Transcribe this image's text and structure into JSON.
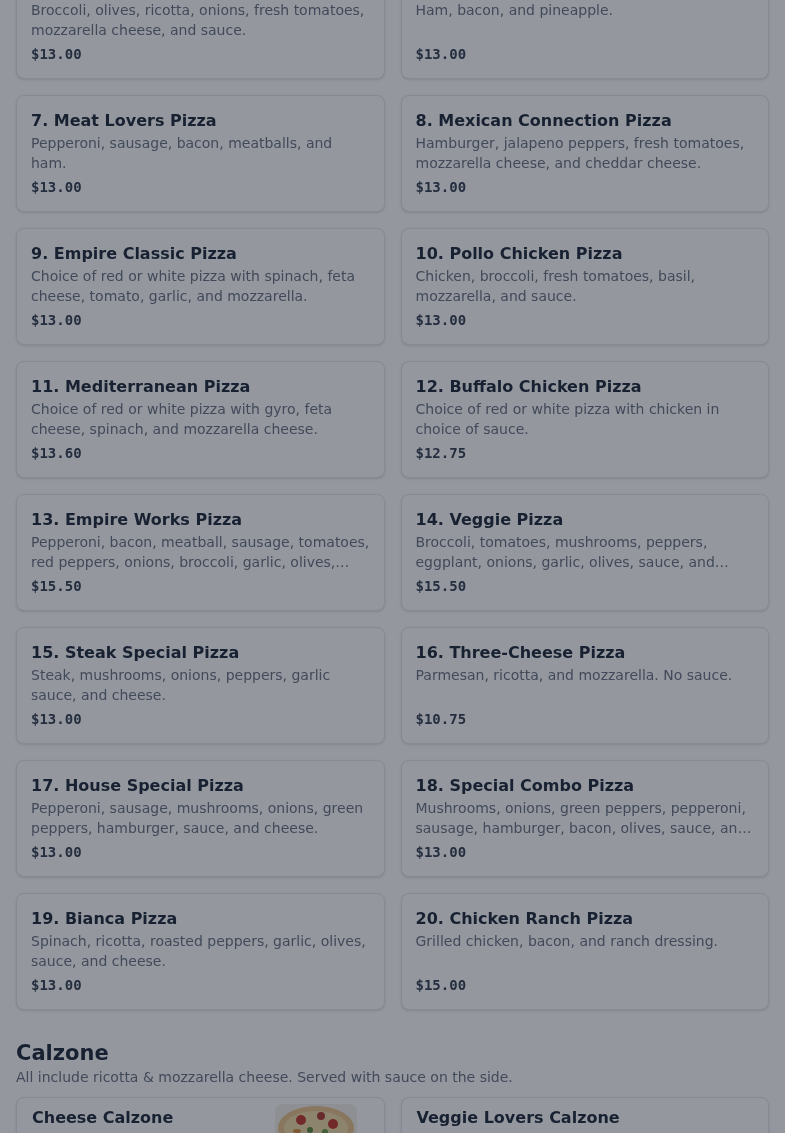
{
  "backdrop_dimmed": true,
  "pizza_items": [
    {
      "description": "Broccoli, olives, ricotta, onions, fresh tomatoes, mozzarella cheese, and sauce.",
      "price": "$13.00"
    },
    {
      "description": "Ham, bacon, and pineapple.",
      "price": "$13.00"
    },
    {
      "name": "7. Meat Lovers Pizza",
      "description": "Pepperoni, sausage, bacon, meatballs, and ham.",
      "price": "$13.00"
    },
    {
      "name": "8. Mexican Connection Pizza",
      "description": "Hamburger, jalapeno peppers, fresh tomatoes, mozzarella cheese, and cheddar cheese.",
      "price": "$13.00"
    },
    {
      "name": "9. Empire Classic Pizza",
      "description": "Choice of red or white pizza with spinach, feta cheese, tomato, garlic, and mozzarella.",
      "price": "$13.00"
    },
    {
      "name": "10. Pollo Chicken Pizza",
      "description": "Chicken, broccoli, fresh tomatoes, basil, mozzarella, and sauce.",
      "price": "$13.00"
    },
    {
      "name": "11. Mediterranean Pizza",
      "description": "Choice of red or white pizza with gyro, feta cheese, spinach, and mozzarella cheese.",
      "price": "$13.60"
    },
    {
      "name": "12. Buffalo Chicken Pizza",
      "description": "Choice of red or white pizza with chicken in choice of sauce.",
      "price": "$12.75"
    },
    {
      "name": "13. Empire Works Pizza",
      "description": "Pepperoni, bacon, meatball, sausage, tomatoes, red peppers, onions, broccoli, garlic, olives,…",
      "price": "$15.50"
    },
    {
      "name": "14. Veggie Pizza",
      "description": "Broccoli, tomatoes, mushrooms, peppers, eggplant, onions, garlic, olives, sauce, and…",
      "price": "$15.50"
    },
    {
      "name": "15. Steak Special Pizza",
      "description": "Steak, mushrooms, onions, peppers, garlic sauce, and cheese.",
      "price": "$13.00"
    },
    {
      "name": "16. Three-Cheese Pizza",
      "description": "Parmesan, ricotta, and mozzarella. No sauce.",
      "price": "$10.75"
    },
    {
      "name": "17. House Special Pizza",
      "description": "Pepperoni, sausage, mushrooms, onions, green peppers, hamburger, sauce, and cheese.",
      "price": "$13.00"
    },
    {
      "name": "18. Special Combo Pizza",
      "description": "Mushrooms, onions, green peppers, pepperoni, sausage, hamburger, bacon, olives, sauce, an…",
      "price": "$13.00"
    },
    {
      "name": "19. Bianca Pizza",
      "description": "Spinach, ricotta, roasted peppers, garlic, olives, sauce, and cheese.",
      "price": "$13.00"
    },
    {
      "name": "20. Chicken Ranch Pizza",
      "description": "Grilled chicken, bacon, and ranch dressing.",
      "price": "$15.00"
    }
  ],
  "calzone_section": {
    "title": "Calzone",
    "subtitle": "All include ricotta & mozzarella cheese. Served with sauce on the side.",
    "items": [
      {
        "name": "Cheese Calzone"
      },
      {
        "name": "Veggie Lovers Calzone"
      }
    ]
  }
}
